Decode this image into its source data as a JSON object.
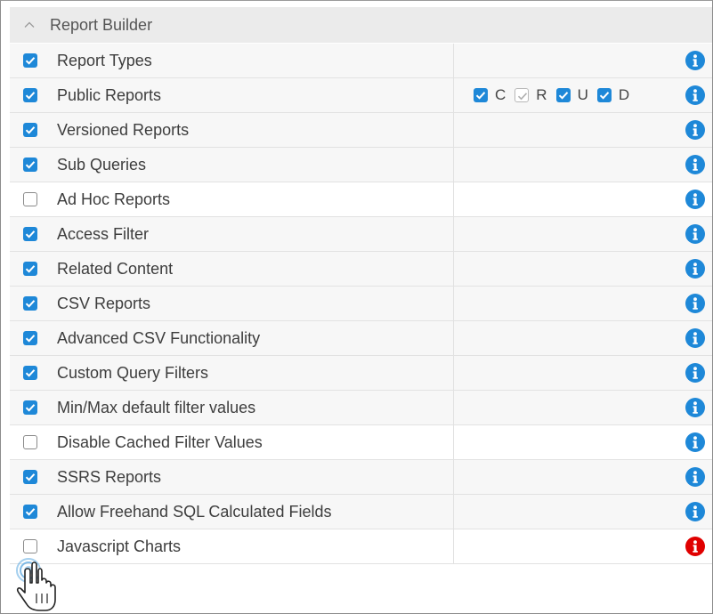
{
  "section": {
    "title": "Report Builder",
    "collapse_icon": "chevron-up-icon"
  },
  "colors": {
    "accent": "#1e88d8",
    "info_blue": "#1e88d8",
    "info_red": "#e00000",
    "header_bg": "#ebebeb",
    "row_shaded": "#f7f7f7"
  },
  "rows": [
    {
      "label": "Report Types",
      "checked": true,
      "info_color": "blue"
    },
    {
      "label": "Public Reports",
      "checked": true,
      "info_color": "blue"
    },
    {
      "label": "Versioned Reports",
      "checked": true,
      "info_color": "blue"
    },
    {
      "label": "Sub Queries",
      "checked": true,
      "info_color": "blue"
    },
    {
      "label": "Ad Hoc Reports",
      "checked": false,
      "info_color": "blue"
    },
    {
      "label": "Access Filter",
      "checked": true,
      "info_color": "blue"
    },
    {
      "label": "Related Content",
      "checked": true,
      "info_color": "blue"
    },
    {
      "label": "CSV Reports",
      "checked": true,
      "info_color": "blue"
    },
    {
      "label": "Advanced CSV Functionality",
      "checked": true,
      "info_color": "blue"
    },
    {
      "label": "Custom Query Filters",
      "checked": true,
      "info_color": "blue"
    },
    {
      "label": "Min/Max default filter values",
      "checked": true,
      "info_color": "blue"
    },
    {
      "label": "Disable Cached Filter Values",
      "checked": false,
      "info_color": "blue"
    },
    {
      "label": "SSRS Reports",
      "checked": true,
      "info_color": "blue"
    },
    {
      "label": "Allow Freehand SQL Calculated Fields",
      "checked": true,
      "info_color": "blue"
    },
    {
      "label": "Javascript Charts",
      "checked": false,
      "info_color": "red"
    }
  ],
  "crud": [
    {
      "letter": "C",
      "state": "checked"
    },
    {
      "letter": "R",
      "state": "checked-disabled"
    },
    {
      "letter": "U",
      "state": "checked"
    },
    {
      "letter": "D",
      "state": "checked"
    }
  ],
  "cursor_icon": "hand-pointer-cursor-icon"
}
